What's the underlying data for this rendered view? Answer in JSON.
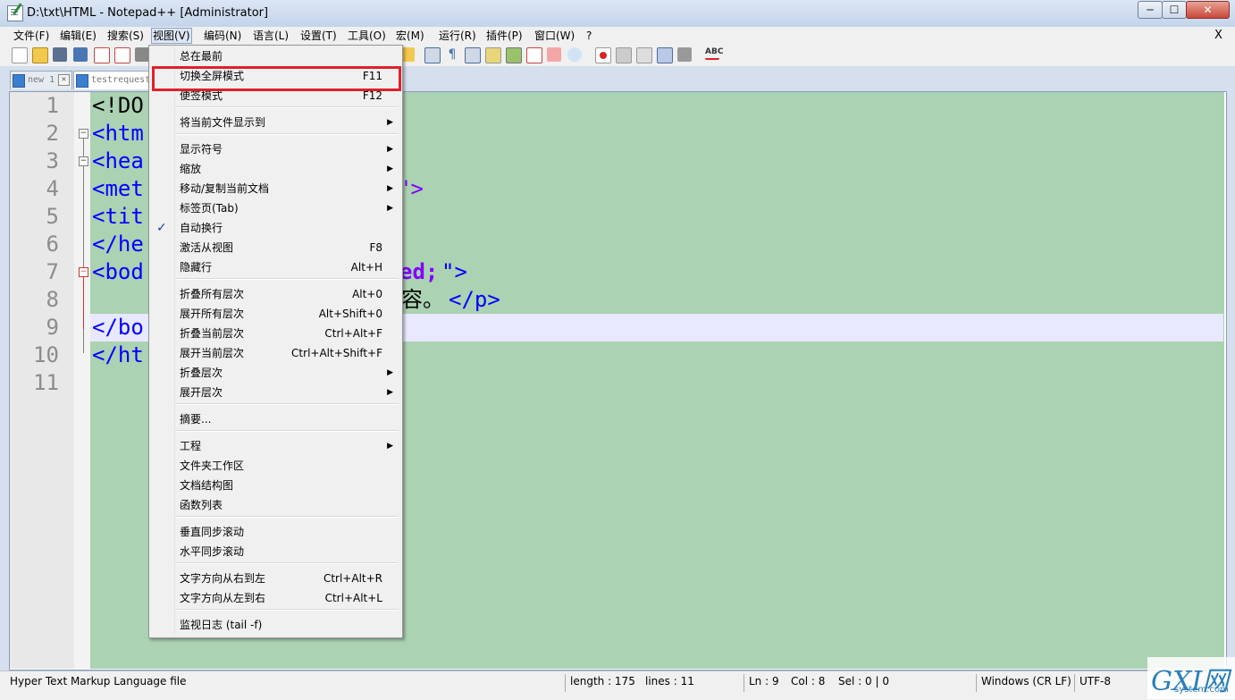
{
  "window": {
    "title": "D:\\txt\\HTML - Notepad++ [Administrator]",
    "min": "─",
    "max": "☐",
    "close": "✕"
  },
  "menubar": {
    "items": [
      "文件(F)",
      "编辑(E)",
      "搜索(S)",
      "视图(V)",
      "编码(N)",
      "语言(L)",
      "设置(T)",
      "工具(O)",
      "宏(M)",
      "运行(R)",
      "插件(P)",
      "窗口(W)",
      "?"
    ],
    "close": "X"
  },
  "tabs": [
    {
      "label": "new 1",
      "close": "✕"
    },
    {
      "label": "testrequest"
    }
  ],
  "editor": {
    "line_numbers": [
      "1",
      "2",
      "3",
      "4",
      "5",
      "6",
      "7",
      "8",
      "9",
      "10",
      "11"
    ],
    "code": {
      "l1": "<!DO",
      "l2": "<htm",
      "l3": "<hea",
      "l4": "<met",
      "l4b": "\">",
      "l5": "<tit",
      "l6": "</he",
      "l7": "<bod",
      "l7b": "ed;",
      "l7c": "\">",
      "l8": "容。",
      "l8b": "</p>",
      "l9": "</bo",
      "l10": "</ht"
    },
    "fold_minus": "−"
  },
  "view_menu": {
    "items": [
      {
        "label": "总在最前",
        "key": ""
      },
      {
        "label": "切换全屏模式",
        "key": "F11"
      },
      {
        "label": "便签模式",
        "key": "F12"
      },
      {
        "label": "将当前文件显示到",
        "key": ""
      },
      {
        "label": "显示符号",
        "key": ""
      },
      {
        "label": "缩放",
        "key": ""
      },
      {
        "label": "移动/复制当前文档",
        "key": ""
      },
      {
        "label": "标签页(Tab)",
        "key": ""
      },
      {
        "label": "自动换行",
        "key": ""
      },
      {
        "label": "激活从视图",
        "key": "F8"
      },
      {
        "label": "隐藏行",
        "key": "Alt+H"
      },
      {
        "label": "折叠所有层次",
        "key": "Alt+0"
      },
      {
        "label": "展开所有层次",
        "key": "Alt+Shift+0"
      },
      {
        "label": "折叠当前层次",
        "key": "Ctrl+Alt+F"
      },
      {
        "label": "展开当前层次",
        "key": "Ctrl+Alt+Shift+F"
      },
      {
        "label": "折叠层次",
        "key": ""
      },
      {
        "label": "展开层次",
        "key": ""
      },
      {
        "label": "摘要...",
        "key": ""
      },
      {
        "label": "工程",
        "key": ""
      },
      {
        "label": "文件夹工作区",
        "key": ""
      },
      {
        "label": "文档结构图",
        "key": ""
      },
      {
        "label": "函数列表",
        "key": ""
      },
      {
        "label": "垂直同步滚动",
        "key": ""
      },
      {
        "label": "水平同步滚动",
        "key": ""
      },
      {
        "label": "文字方向从右到左",
        "key": "Ctrl+Alt+R"
      },
      {
        "label": "文字方向从左到右",
        "key": "Ctrl+Alt+L"
      },
      {
        "label": "监视日志 (tail -f)",
        "key": ""
      }
    ],
    "submenu_arrow": "▶",
    "check": "✓"
  },
  "statusbar": {
    "filetype": "Hyper Text Markup Language file",
    "length": "length : 175",
    "lines": "lines : 11",
    "ln": "Ln : 9",
    "col": "Col : 8",
    "sel": "Sel : 0 | 0",
    "eol": "Windows (CR LF)",
    "encoding": "UTF-8"
  },
  "watermark": {
    "text": "GXI网",
    "sub": "system.com"
  },
  "colors": {
    "editor_bg": "#abd2b2",
    "tag": "#0000ff",
    "highlight": "#e0202a",
    "current_line": "#e8e8ff"
  }
}
